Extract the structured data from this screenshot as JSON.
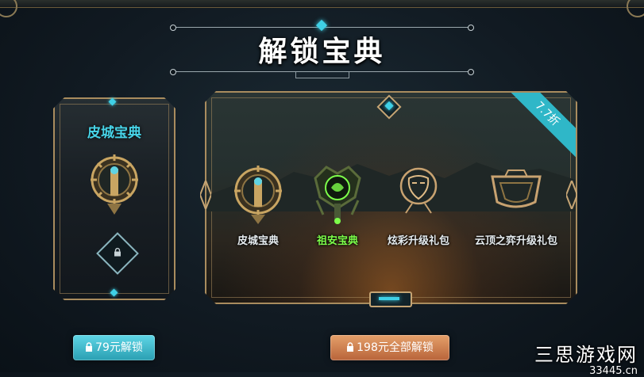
{
  "page": {
    "title": "解锁宝典"
  },
  "left_card": {
    "title": "皮城宝典",
    "icon": "piltover-pass-emblem-icon",
    "lock_icon": "lock-icon"
  },
  "right_card": {
    "discount_badge": "7.7折",
    "items": [
      {
        "label": "皮城宝典",
        "icon": "piltover-pass-emblem-icon",
        "color": "#e6ecef"
      },
      {
        "label": "祖安宝典",
        "icon": "zaun-pass-emblem-icon",
        "color": "#7dff4a"
      },
      {
        "label": "炫彩升级礼包",
        "icon": "chroma-mask-icon",
        "color": "#e6ecef"
      },
      {
        "label": "云顶之弈升级礼包",
        "icon": "tft-arena-icon",
        "color": "#e6ecef"
      }
    ]
  },
  "buttons": {
    "unlock_single": "79元解锁",
    "unlock_all": "198元全部解锁"
  },
  "watermark": {
    "line1": "三思游戏网",
    "line2": "33445.cn"
  },
  "colors": {
    "accent_cyan": "#3fd0e6",
    "gold_border": "#a98c5e",
    "button_blue": "#2a9fb2",
    "button_orange": "#b8643a",
    "highlight_green": "#7dff4a"
  }
}
